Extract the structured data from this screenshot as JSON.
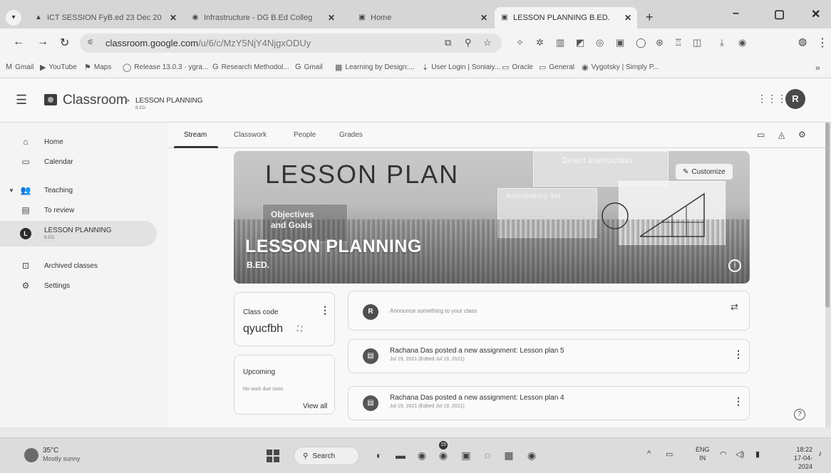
{
  "browser": {
    "tabs": [
      {
        "label": "ICT SESSION FyB.ed 23 Dec 20",
        "icon": "drive-icon"
      },
      {
        "label": "Infrastructure - DG B.Ed Colleg",
        "icon": "globe-icon"
      },
      {
        "label": "Home",
        "icon": "classroom-icon"
      },
      {
        "label": "LESSON PLANNING B.ED.",
        "icon": "classroom-icon",
        "active": true
      }
    ],
    "new_tab": "+",
    "address": {
      "host": "classroom.google.com",
      "path": "/u/6/c/MzY5NjY4NjgxODUy"
    },
    "bookmarks": [
      {
        "label": "Gmail",
        "icon": "M"
      },
      {
        "label": "YouTube",
        "icon": "▶"
      },
      {
        "label": "Maps",
        "icon": "⚑"
      },
      {
        "label": "Release 13.0.3 · ygra...",
        "icon": "◯"
      },
      {
        "label": "Research Methodol...",
        "icon": "G"
      },
      {
        "label": "Gmail",
        "icon": "G"
      },
      {
        "label": "Learning by Design:...",
        "icon": "▦"
      },
      {
        "label": "User Login | Soniaiy...",
        "icon": "⇣"
      },
      {
        "label": "Oracle",
        "icon": "▭"
      },
      {
        "label": "General",
        "icon": "▭"
      },
      {
        "label": "Vygotsky | Simply P...",
        "icon": "◉"
      }
    ],
    "bookmarks_more": "»"
  },
  "header": {
    "brand": "Classroom",
    "chevron": ">",
    "class_name": "LESSON PLANNING",
    "class_section": "B.ED.",
    "profile_initial": "R"
  },
  "sidebar": {
    "items": [
      {
        "label": "Home",
        "icon": "⌂"
      },
      {
        "label": "Calendar",
        "icon": "▭"
      },
      {
        "label": "Teaching",
        "icon": "👥"
      },
      {
        "label": "To review",
        "icon": "▤"
      },
      {
        "label": "LESSON PLANNING",
        "sub": "B.ED.",
        "icon": "L"
      },
      {
        "label": "Archived classes",
        "icon": "⊡"
      },
      {
        "label": "Settings",
        "icon": "⚙"
      }
    ]
  },
  "class_tabs": [
    "Stream",
    "Classwork",
    "People",
    "Grades"
  ],
  "banner": {
    "headline": "LESSON PLAN",
    "objectives": "Objectives and Goals",
    "direct": "Direct Instruction",
    "anticipatory": "Anticipatory Set",
    "title": "LESSON PLANNING",
    "section": "B.ED.",
    "customize_label": "Customize",
    "info": "i"
  },
  "class_code": {
    "label": "Class code",
    "value": "qyucfbh"
  },
  "upcoming": {
    "label": "Upcoming",
    "empty": "No work due soon",
    "view_all": "View all"
  },
  "announce": {
    "avatar": "R",
    "placeholder": "Announce something to your class"
  },
  "posts": [
    {
      "title": "Rachana Das posted a new assignment: Lesson plan 5",
      "date": "Jul 19, 2021 (Edited Jul 19, 2021)"
    },
    {
      "title": "Rachana Das posted a new assignment: Lesson plan 4",
      "date": "Jul 19, 2021 (Edited Jul 19, 2021)"
    }
  ],
  "taskbar": {
    "weather_temp": "35°C",
    "weather_desc": "Mostly sunny",
    "search_label": "Search",
    "badge": "15",
    "lang_top": "ENG",
    "lang_bottom": "IN",
    "time": "18:22",
    "date": "17-04-2024"
  }
}
